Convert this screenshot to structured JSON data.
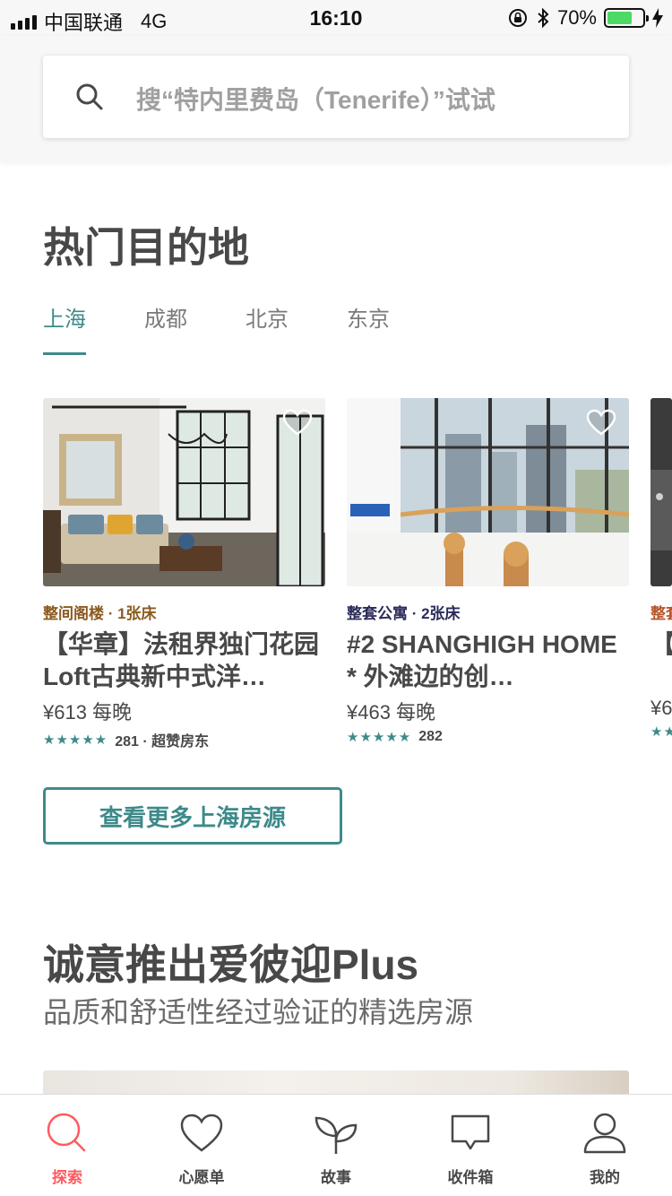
{
  "status_bar": {
    "carrier": "中国联通",
    "network": "4G",
    "time": "16:10",
    "battery": "70%",
    "battery_level": 0.7
  },
  "search": {
    "placeholder": "搜“特内里费岛（Tenerife）”试试"
  },
  "popular": {
    "title": "热门目的地",
    "tabs": [
      "上海",
      "成都",
      "北京",
      "东京"
    ],
    "active_tab": "上海",
    "listings": [
      {
        "type": "整间阁楼 · 1张床",
        "type_color": "#8a5a1e",
        "name": "【华章】法租界独门花园Loft古典新中式洋…",
        "price": "¥613 每晚",
        "stars": "★★★★★",
        "rating_text": "281 · 超赞房东"
      },
      {
        "type": "整套公寓 · 2张床",
        "type_color": "#2b2b5a",
        "name": "#2 SHANGHIGH HOME * 外滩边的创…",
        "price": "¥463 每晚",
        "stars": "★★★★★",
        "rating_text": "282"
      },
      {
        "type": "整套",
        "type_color": "#b5552a",
        "name": "【心",
        "price": "¥6",
        "stars": "★★",
        "rating_text": ""
      }
    ],
    "more_button": "查看更多上海房源"
  },
  "plus": {
    "title": "诚意推出爱彼迎Plus",
    "subtitle": "品质和舒适性经过验证的精选房源"
  },
  "tabbar": {
    "items": [
      {
        "label": "探索",
        "icon": "search-icon",
        "active": true
      },
      {
        "label": "心愿单",
        "icon": "heart-icon",
        "active": false
      },
      {
        "label": "故事",
        "icon": "sprout-icon",
        "active": false
      },
      {
        "label": "收件箱",
        "icon": "chat-bubble-icon",
        "active": false
      },
      {
        "label": "我的",
        "icon": "profile-icon",
        "active": false
      }
    ]
  },
  "colors": {
    "accent": "#3e8a8a",
    "brand": "#ff5a5f"
  }
}
